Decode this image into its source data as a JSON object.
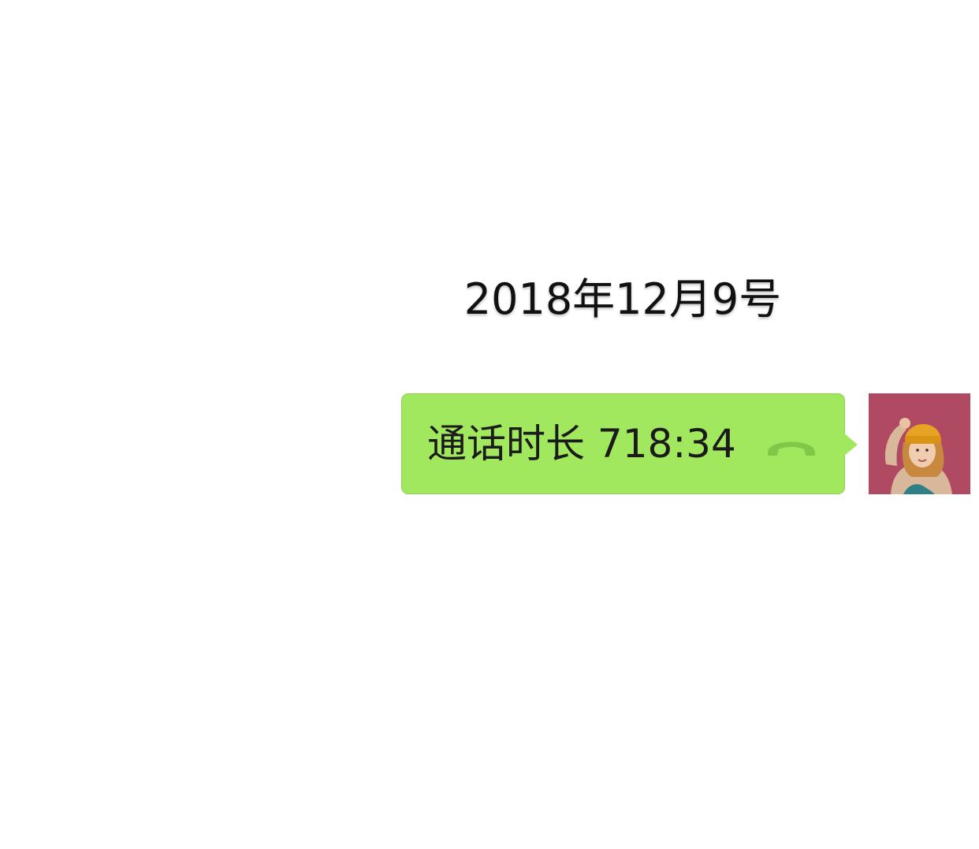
{
  "chat": {
    "date_label": "2018年12月9号",
    "message": {
      "text": "通话时长 718:34",
      "type": "voice-call",
      "bubble_color": "#a1e85e",
      "icon": "phone-hangup-icon"
    },
    "avatar": {
      "description_icon": "avatar-icon",
      "background_color": "#b04a63"
    }
  }
}
